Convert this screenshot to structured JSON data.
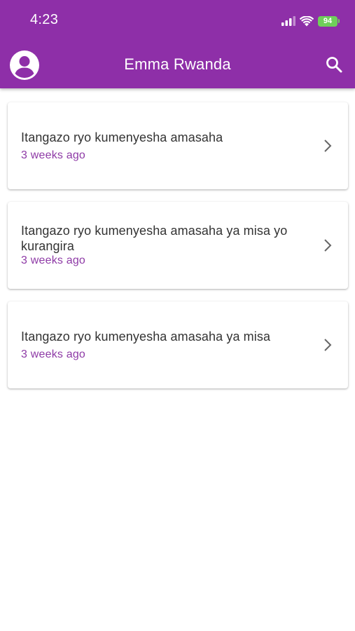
{
  "status_bar": {
    "time": "4:23",
    "battery": "94"
  },
  "app_bar": {
    "title": "Emma Rwanda",
    "avatar_icon": "account-circle-icon",
    "search_icon": "search-icon"
  },
  "colors": {
    "primary": "#8e2fa8",
    "subtitle": "#8e3aa6",
    "battery": "#6fcf5a"
  },
  "items": [
    {
      "title": "Itangazo ryo kumenyesha amasaha",
      "subtitle": "3 weeks ago"
    },
    {
      "title": "Itangazo ryo kumenyesha amasaha ya misa yo kurangira",
      "subtitle": "3 weeks ago"
    },
    {
      "title": "Itangazo ryo kumenyesha amasaha ya misa",
      "subtitle": "3 weeks ago"
    }
  ]
}
